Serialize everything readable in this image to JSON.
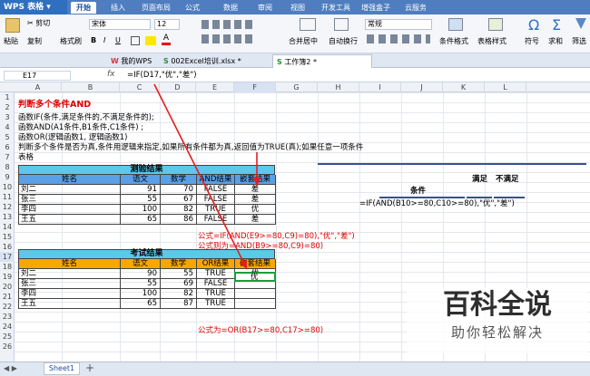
{
  "app": {
    "name": "WPS 表格"
  },
  "menu": [
    "开始",
    "插入",
    "页面布局",
    "公式",
    "数据",
    "审阅",
    "视图",
    "开发工具",
    "增强盒子",
    "云服务"
  ],
  "ribbon": {
    "paste": "粘贴",
    "cut": "剪切",
    "copy": "复制",
    "format_painter": "格式刷",
    "font": "宋体",
    "size": "12",
    "bold": "B",
    "italic": "I",
    "underline": "U",
    "merge": "合并居中",
    "wrap": "自动换行",
    "number_format": "常规",
    "cond_format": "条件格式",
    "table_style": "表格样式",
    "symbol": "符号",
    "sum": "求和",
    "filter": "筛选",
    "symbol_glyph": "Ω",
    "sum_glyph": "Σ"
  },
  "tabs": {
    "home": "我的WPS",
    "file1": "002Excel培训.xlsx *",
    "file2": "工作簿2 *"
  },
  "formula_bar": {
    "cell_ref": "E17",
    "fx": "fx",
    "formula": "=IF(D17,\"优\",\"差\")"
  },
  "columns": [
    "A",
    "B",
    "C",
    "D",
    "E",
    "F",
    "G",
    "H",
    "I",
    "J",
    "K",
    "L"
  ],
  "rows": [
    "1",
    "2",
    "3",
    "4",
    "5",
    "6",
    "7",
    "8",
    "9",
    "10",
    "11",
    "12",
    "13",
    "14",
    "15",
    "16",
    "17",
    "18",
    "19",
    "20",
    "21",
    "22",
    "23",
    "24",
    "25",
    "26"
  ],
  "sheet": {
    "title": "判断多个条件AND",
    "line3": "函数IF(条件,满足条件的,不满足条件的);",
    "line4": "函数AND(A1条件,B1条件,C1条件) ;",
    "line5": "函数OR(逻辑函数1, 逻辑函数1)",
    "line6": "判断多个条件是否为真,条件用逻辑来指定,如果所有条件都为真,返回值为TRUE(真);如果任意一项条件",
    "line7": "表格"
  },
  "table1": {
    "title": "测验结果",
    "headers": [
      "姓名",
      "语文",
      "数学",
      "AND结果",
      "嵌套结果"
    ],
    "rows": [
      [
        "刘二",
        "91",
        "70",
        "FALSE",
        "差"
      ],
      [
        "张三",
        "55",
        "67",
        "FALSE",
        "差"
      ],
      [
        "李四",
        "100",
        "82",
        "TRUE",
        "优"
      ],
      [
        "王五",
        "65",
        "86",
        "FALSE",
        "差"
      ]
    ]
  },
  "table2": {
    "title": "考试结果",
    "headers": [
      "姓名",
      "语文",
      "数学",
      "OR结果",
      "嵌套结果"
    ],
    "rows": [
      [
        "刘二",
        "90",
        "55",
        "TRUE",
        "优"
      ],
      [
        "张三",
        "55",
        "69",
        "FALSE",
        ""
      ],
      [
        "李四",
        "100",
        "82",
        "TRUE",
        ""
      ],
      [
        "王五",
        "65",
        "87",
        "TRUE",
        ""
      ]
    ]
  },
  "notes": {
    "n1": "公式=IF(AND(E9>=80,C9)=80),\"优\",\"差\")",
    "n2": "公式则为=AND(B9>=80,C9)=80)",
    "n3": "公式为=OR(B17>=80,C17>=80)"
  },
  "diagram": {
    "satisfied": "满足",
    "not_satisfied": "不满足",
    "condition": "条件",
    "formula": "=IF(AND(B10>=80,C10>=80),\"优\",\"差\")"
  },
  "sheet_tab": "Sheet1",
  "watermark": {
    "main": "百科全说",
    "sub": "助你轻松解决"
  },
  "colors": {
    "accent": "#4f7dbf",
    "header_blue": "#5aa0e6",
    "header_orange": "#f7a800",
    "title_cyan": "#5bc8ec",
    "red": "#e00000",
    "arrow": "#e02020"
  }
}
